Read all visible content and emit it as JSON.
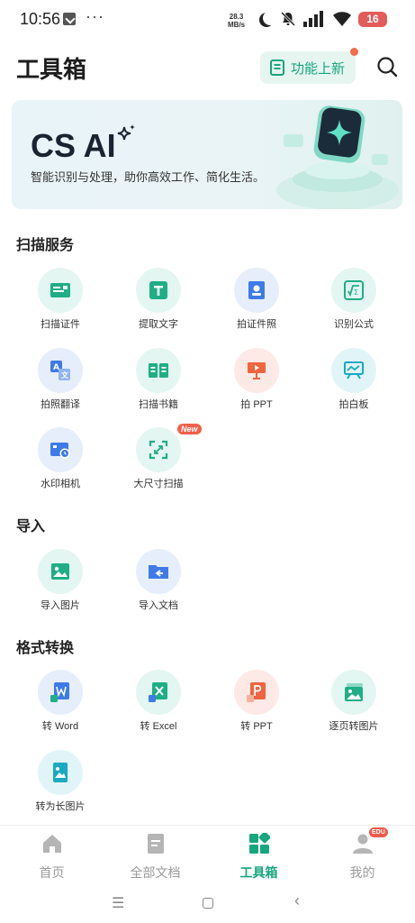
{
  "status_bar": {
    "time": "10:56",
    "more": "···",
    "speed_value": "28.3",
    "speed_unit": "MB/s",
    "battery": "16"
  },
  "header": {
    "title": "工具箱",
    "whatsnew_label": "功能上新"
  },
  "banner": {
    "title": "CS AI",
    "subtitle": "智能识别与处理，助你高效工作、简化生活。"
  },
  "sections": {
    "scan": {
      "title": "扫描服务",
      "items": [
        {
          "label": "扫描证件",
          "icon": "id-card-icon"
        },
        {
          "label": "提取文字",
          "icon": "text-t-icon"
        },
        {
          "label": "拍证件照",
          "icon": "portrait-icon"
        },
        {
          "label": "识别公式",
          "icon": "formula-icon"
        },
        {
          "label": "拍照翻译",
          "icon": "translate-icon"
        },
        {
          "label": "扫描书籍",
          "icon": "book-icon"
        },
        {
          "label": "拍 PPT",
          "icon": "presentation-icon"
        },
        {
          "label": "拍白板",
          "icon": "whiteboard-icon"
        },
        {
          "label": "水印相机",
          "icon": "watermark-camera-icon"
        },
        {
          "label": "大尺寸扫描",
          "icon": "large-scan-icon",
          "badge": "New"
        }
      ]
    },
    "import": {
      "title": "导入",
      "items": [
        {
          "label": "导入图片",
          "icon": "image-icon"
        },
        {
          "label": "导入文档",
          "icon": "folder-import-icon"
        }
      ]
    },
    "convert": {
      "title": "格式转换",
      "items": [
        {
          "label": "转 Word",
          "icon": "word-icon"
        },
        {
          "label": "转 Excel",
          "icon": "excel-icon"
        },
        {
          "label": "转 PPT",
          "icon": "ppt-icon"
        },
        {
          "label": "逐页转图片",
          "icon": "pages-to-image-icon"
        },
        {
          "label": "转为长图片",
          "icon": "long-image-icon"
        }
      ]
    }
  },
  "bottom_nav": {
    "items": [
      {
        "label": "首页"
      },
      {
        "label": "全部文档"
      },
      {
        "label": "工具箱"
      },
      {
        "label": "我的",
        "badge": "EDU"
      }
    ]
  },
  "colors": {
    "accent": "#19a67f",
    "badge_red": "#f35f4a"
  }
}
